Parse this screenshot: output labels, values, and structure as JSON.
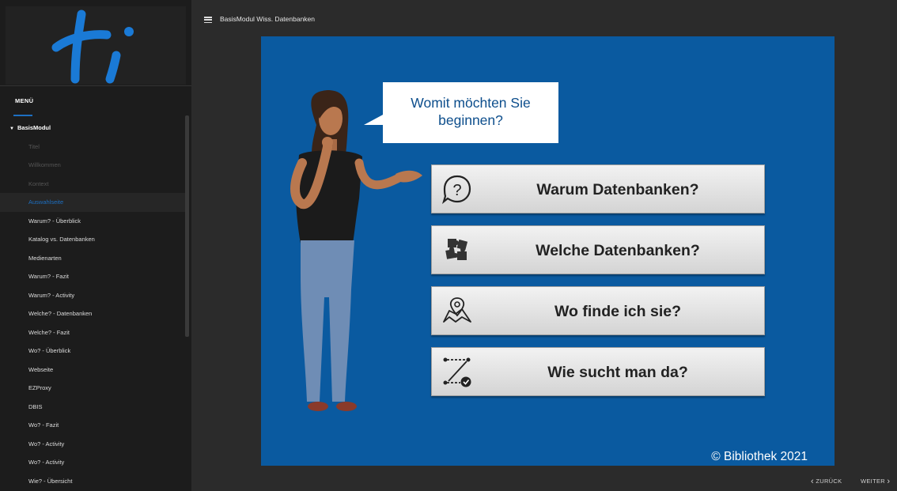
{
  "window": {
    "course_title": "BasisModul Wiss. Datenbanken"
  },
  "sidebar": {
    "menu_label": "MENÜ",
    "parent_label": "BasisModul",
    "items": [
      {
        "label": "Titel",
        "state": "visited"
      },
      {
        "label": "Willkommen",
        "state": "visited"
      },
      {
        "label": "Kontext",
        "state": "visited"
      },
      {
        "label": "Auswahlseite",
        "state": "active"
      },
      {
        "label": "Warum? - Überblick",
        "state": "normal"
      },
      {
        "label": "Katalog vs. Datenbanken",
        "state": "normal"
      },
      {
        "label": "Medienarten",
        "state": "normal"
      },
      {
        "label": "Warum? - Fazit",
        "state": "normal"
      },
      {
        "label": "Warum? - Activity",
        "state": "normal"
      },
      {
        "label": "Welche? - Datenbanken",
        "state": "normal"
      },
      {
        "label": "Welche? - Fazit",
        "state": "normal"
      },
      {
        "label": "Wo? - Überblick",
        "state": "normal"
      },
      {
        "label": "Webseite",
        "state": "normal"
      },
      {
        "label": "EZProxy",
        "state": "normal"
      },
      {
        "label": "DBIS",
        "state": "normal"
      },
      {
        "label": "Wo? - Fazit",
        "state": "normal"
      },
      {
        "label": "Wo? - Activity",
        "state": "normal"
      },
      {
        "label": "Wo? - Activity",
        "state": "normal"
      },
      {
        "label": "Wie? - Übersicht",
        "state": "normal"
      }
    ]
  },
  "slide": {
    "bubble_text": "Womit möchten Sie\nbeginnen?",
    "choices": [
      {
        "label": "Warum Datenbanken?",
        "icon": "question-bubble-icon"
      },
      {
        "label": "Welche Datenbanken?",
        "icon": "puzzle-icon"
      },
      {
        "label": "Wo finde ich sie?",
        "icon": "map-icon"
      },
      {
        "label": "Wie sucht man da?",
        "icon": "route-icon"
      }
    ],
    "copyright": "© Bibliothek 2021"
  },
  "nav": {
    "back_label": "ZURÜCK",
    "next_label": "WEITER"
  },
  "colors": {
    "accent": "#1d6fc1",
    "slide_bg": "#0a5aa0",
    "sidebar_bg": "#1c1c1c",
    "app_bg": "#2b2b2b"
  }
}
